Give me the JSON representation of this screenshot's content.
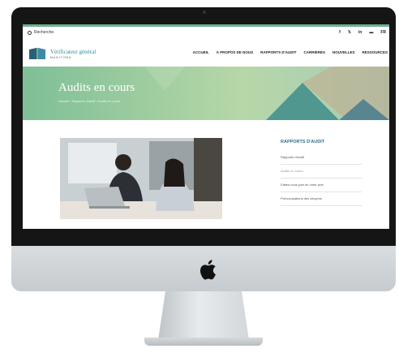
{
  "topbar": {
    "search_label": "Recherche",
    "socials": [
      "f",
      "𝕏",
      "in",
      "▬",
      "FR"
    ]
  },
  "brand": {
    "title": "Vérificateur général",
    "subtitle": "MANITOBA"
  },
  "menu": [
    "ACCUEIL",
    "À PROPOS DE NOUS",
    "RAPPORTS D'AUDIT",
    "CARRIÈRES",
    "NOUVELLES",
    "RESSOURCES"
  ],
  "hero": {
    "title": "Audits en cours",
    "breadcrumb": "Accueil › Rapports d'audit › Audits en cours"
  },
  "sidebar": {
    "heading": "RAPPORTS D'AUDIT",
    "items": [
      "Rapports d'audit",
      "Audits en cours",
      "Faites-nous part de votre avis",
      "Préoccupations des citoyens"
    ]
  },
  "colors": {
    "accent_green": "#6eae8e",
    "heading_blue": "#2f6f8f",
    "bezel": "#151515"
  }
}
